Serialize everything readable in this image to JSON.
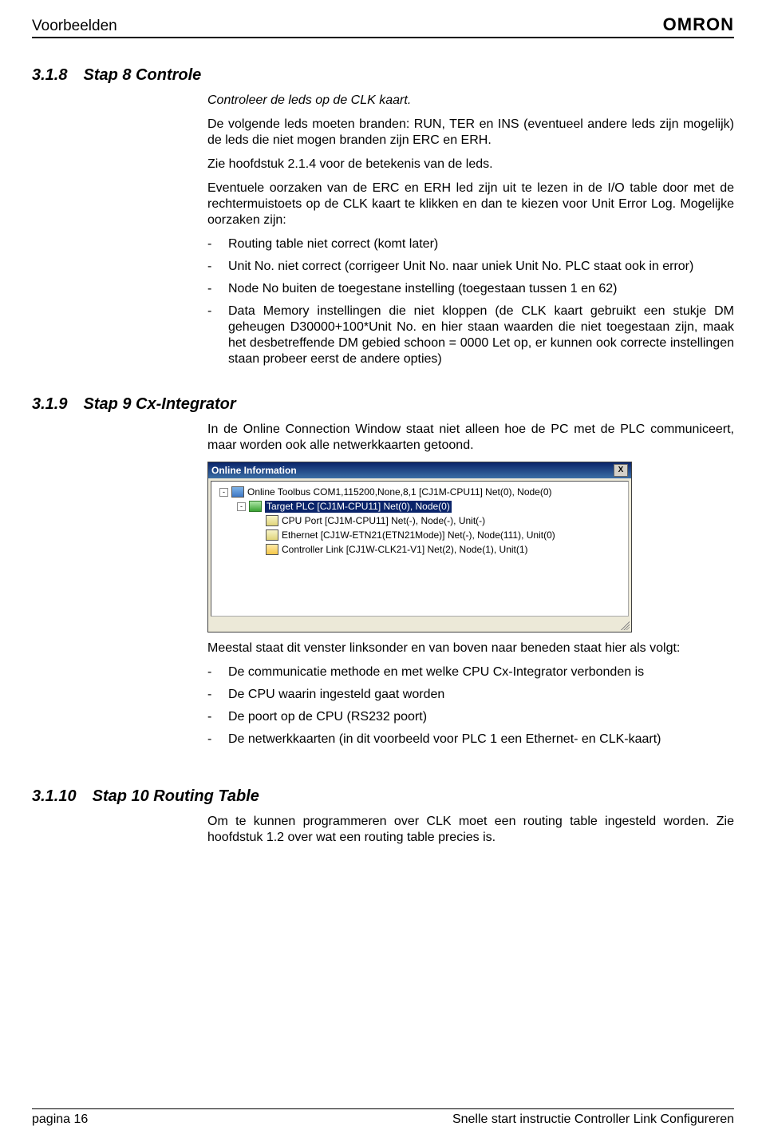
{
  "header": {
    "left": "Voorbeelden",
    "logo": "OMRON"
  },
  "sec318": {
    "num": "3.1.8",
    "title": "Stap 8 Controle",
    "intro": "Controleer de leds op de CLK kaart.",
    "p1": "De volgende leds moeten branden: RUN, TER en INS (eventueel andere leds zijn mogelijk) de leds die niet mogen branden zijn ERC en ERH.",
    "p2": "Zie hoofdstuk 2.1.4 voor de betekenis van de leds.",
    "p3": "Eventuele oorzaken van de ERC en ERH led zijn uit te lezen in de I/O table door met de rechtermuistoets op de CLK kaart te klikken en dan te kiezen voor Unit Error Log. Mogelijke oorzaken zijn:",
    "bullets": [
      "Routing table niet correct (komt later)",
      "Unit No. niet correct (corrigeer Unit No. naar uniek Unit No. PLC staat ook in error)",
      "Node No buiten de toegestane instelling (toegestaan tussen 1 en 62)",
      "Data Memory instellingen die niet kloppen (de CLK kaart gebruikt een stukje DM geheugen D30000+100*Unit No. en hier staan waarden die niet toegestaan zijn, maak het desbetreffende DM gebied schoon = 0000 Let op, er kunnen ook correcte instellingen staan probeer eerst de andere opties)"
    ]
  },
  "sec319": {
    "num": "3.1.9",
    "title": "Stap 9 Cx-Integrator",
    "p1": "In de Online Connection Window staat niet alleen hoe de PC met de PLC communiceert, maar worden ook alle netwerkkaarten getoond.",
    "window": {
      "title": "Online Information",
      "close_label": "X",
      "tree": [
        {
          "indent": 0,
          "toggle": "-",
          "icon": "cpu",
          "selected": false,
          "label": "Online Toolbus COM1,115200,None,8,1 [CJ1M-CPU11] Net(0), Node(0)"
        },
        {
          "indent": 1,
          "toggle": "-",
          "icon": "plc",
          "selected": true,
          "label": "Target PLC [CJ1M-CPU11] Net(0), Node(0)"
        },
        {
          "indent": 2,
          "toggle": "",
          "icon": "port",
          "selected": false,
          "label": "CPU Port [CJ1M-CPU11] Net(-), Node(-), Unit(-)"
        },
        {
          "indent": 2,
          "toggle": "",
          "icon": "eth",
          "selected": false,
          "label": "Ethernet [CJ1W-ETN21(ETN21Mode)] Net(-), Node(111), Unit(0)"
        },
        {
          "indent": 2,
          "toggle": "",
          "icon": "clk",
          "selected": false,
          "label": "Controller Link [CJ1W-CLK21-V1] Net(2), Node(1), Unit(1)"
        }
      ]
    },
    "p2": "Meestal staat dit venster linksonder en van boven naar beneden staat hier als volgt:",
    "bullets": [
      "De communicatie methode en met welke CPU Cx-Integrator verbonden is",
      "De CPU waarin ingesteld gaat worden",
      "De poort op de CPU (RS232 poort)",
      "De netwerkkaarten (in dit voorbeeld voor PLC 1 een Ethernet- en CLK-kaart)"
    ]
  },
  "sec3110": {
    "num": "3.1.10",
    "title": "Stap 10 Routing Table",
    "p1": "Om te kunnen programmeren over CLK moet een routing table ingesteld worden. Zie hoofdstuk 1.2 over wat een routing table precies is."
  },
  "footer": {
    "left": "pagina 16",
    "right": "Snelle start instructie Controller Link Configureren"
  }
}
